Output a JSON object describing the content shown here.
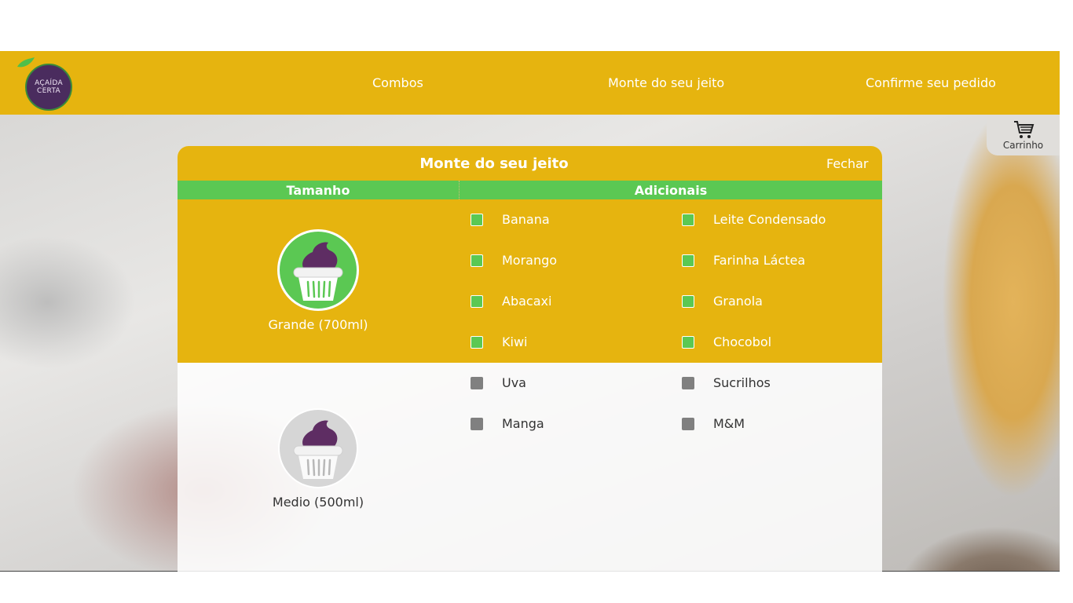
{
  "nav": {
    "logo_line1": "AÇAÍDA",
    "logo_line2": "CERTA",
    "links": [
      "Combos",
      "Monte do seu jeito",
      "Confirme seu pedido"
    ]
  },
  "cart": {
    "label": "Carrinho",
    "icon": "cart-icon"
  },
  "modal": {
    "title": "Monte do seu jeito",
    "close_label": "Fechar",
    "col_size": "Tamanho",
    "col_addons": "Adicionais",
    "sizes": [
      {
        "label": "Grande (700ml)",
        "selected": true
      },
      {
        "label": "Medio (500ml)",
        "selected": false
      }
    ],
    "addons_left": [
      {
        "label": "Banana",
        "checked": true
      },
      {
        "label": "Morango",
        "checked": true
      },
      {
        "label": "Abacaxi",
        "checked": true
      },
      {
        "label": "Kiwi",
        "checked": true
      },
      {
        "label": "Uva",
        "checked": false
      },
      {
        "label": "Manga",
        "checked": false
      }
    ],
    "addons_right": [
      {
        "label": "Leite Condensado",
        "checked": true
      },
      {
        "label": "Farinha Láctea",
        "checked": true
      },
      {
        "label": "Granola",
        "checked": true
      },
      {
        "label": "Chocobol",
        "checked": true
      },
      {
        "label": "Sucrilhos",
        "checked": false
      },
      {
        "label": "M&M",
        "checked": false
      }
    ]
  },
  "colors": {
    "accent_yellow": "#e6b40f",
    "accent_green": "#5bc853",
    "acai_purple": "#5e2d63",
    "unchecked_gray": "#808080"
  }
}
